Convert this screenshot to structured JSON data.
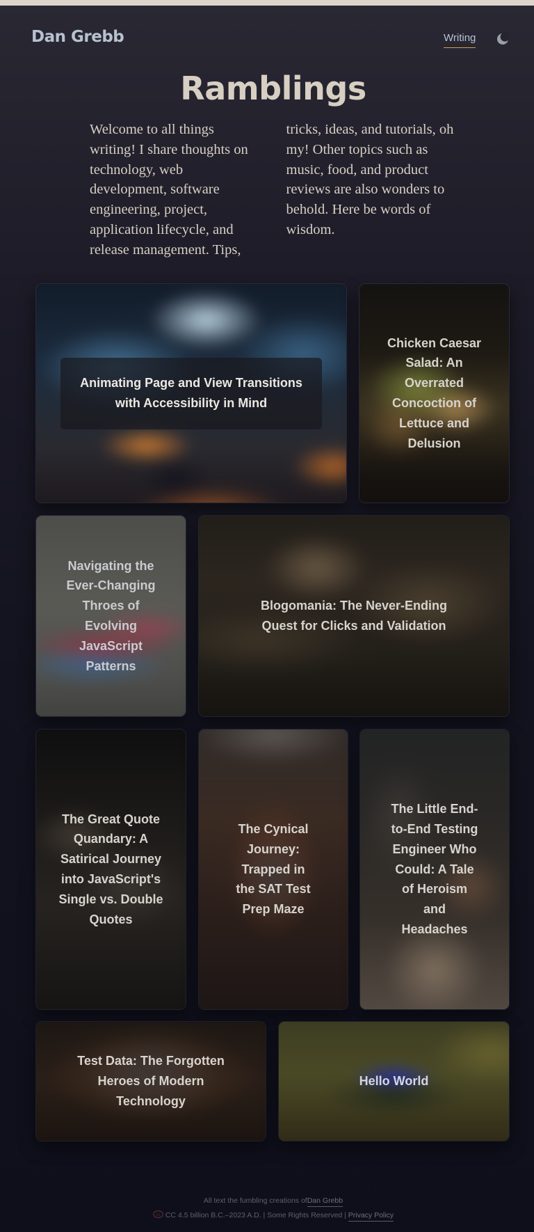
{
  "header": {
    "site_name": "Dan Grebb",
    "nav_writing": "Writing",
    "theme_toggle_icon": "moon-icon"
  },
  "page": {
    "title": "Ramblings",
    "intro": "Welcome to all things writing! I share thoughts on technology, web development, software engineering, project, application lifecycle, and release management. Tips, tricks, ideas, and tutorials, oh my! Other topics such as music, food, and product reviews are also wonders to behold. Here be words of wisdom."
  },
  "posts": [
    {
      "title": "Animating Page and View Transitions with Accessibility in Mind"
    },
    {
      "title": "Chicken Caesar Salad: An Overrated Concoction of Lettuce and Delusion"
    },
    {
      "title": "Navigating the Ever-Changing Throes of Evolving JavaScript Patterns"
    },
    {
      "title": "Blogomania: The Never-Ending Quest for Clicks and Validation"
    },
    {
      "title": "The Great Quote Quandary: A Satirical Journey into JavaScript's Single vs. Double Quotes"
    },
    {
      "title": "The Cynical Journey: Trapped in the SAT Test Prep Maze"
    },
    {
      "title": "The Little End-to-End Testing Engineer Who Could: A Tale of Heroism and Headaches"
    },
    {
      "title": "Test Data: The Forgotten Heroes of Modern Technology"
    },
    {
      "title": "Hello World"
    }
  ],
  "footer": {
    "creations_text": "All text the fumbling creations of",
    "author_link": "Dan Grebb",
    "copyright_text": "CC 4.5 billion B.C.–2023 A.D. | Some Rights Reserved |",
    "privacy_link": "Privacy Policy",
    "cc_icon": "creative-commons-icon"
  },
  "colors": {
    "accent_underline": "#d9a04a",
    "heading": "#d7cfc2",
    "site_name": "#b6c2d0"
  }
}
